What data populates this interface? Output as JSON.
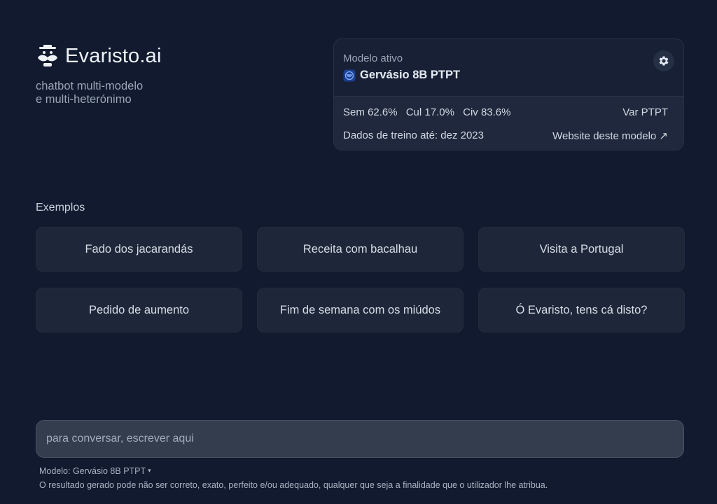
{
  "brand": {
    "name": "Evaristo.ai",
    "tagline_line1": "chatbot multi-modelo",
    "tagline_line2": "e multi-heterónimo",
    "logo_icon": "mustache-hat-icon"
  },
  "model_card": {
    "active_label": "Modelo ativo",
    "model_name": "Gervásio 8B PTPT",
    "model_icon": "globe-icon",
    "settings_icon": "gear-icon",
    "stats": {
      "sem": "Sem 62.6%",
      "cul": "Cul 17.0%",
      "civ": "Civ 83.6%",
      "var": "Var PTPT"
    },
    "training_data": "Dados de treino até: dez 2023",
    "website_link": "Website deste modelo ↗"
  },
  "examples": {
    "label": "Exemplos",
    "items": [
      "Fado dos jacarandás",
      "Receita com bacalhau",
      "Visita a Portugal",
      "Pedido de aumento",
      "Fim de semana com os miúdos",
      "Ó Evaristo, tens cá disto?"
    ]
  },
  "input": {
    "placeholder": "para conversar, escrever aqui",
    "value": ""
  },
  "footer": {
    "model_selector": "Modelo: Gervásio 8B PTPT",
    "caret": "▾",
    "disclaimer": "O resultado gerado pode não ser correto, exato, perfeito e/ou adequado, qualquer que seja a finalidade que o utilizador lhe atribua."
  },
  "colors": {
    "background": "#111a2e",
    "card": "#172035",
    "example_card": "#1e2739",
    "input": "#343d4d",
    "text": "#c9d1de"
  }
}
